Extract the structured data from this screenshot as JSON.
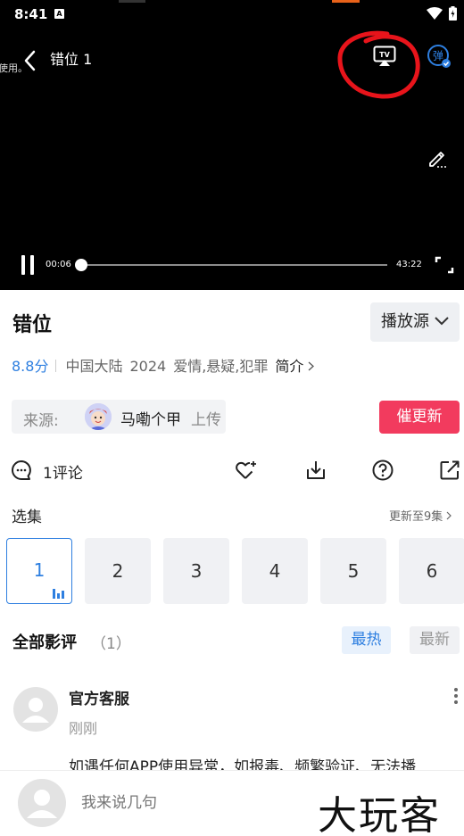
{
  "status_bar": {
    "time": "8:41",
    "notification_badge": "A",
    "icons": [
      "wifi-icon",
      "battery-icon"
    ]
  },
  "player": {
    "title": "错位 1",
    "clipped_text": "使用。",
    "cast_label": "TV",
    "danmu_label": "弹",
    "current_time": "00:06",
    "total_time": "43:22",
    "progress_fraction": 0.002,
    "annotation_color": "#e8141b"
  },
  "show": {
    "title": "错位",
    "source_button": "播放源",
    "score": "8.8分",
    "region": "中国大陆",
    "year": "2024",
    "genres": "爱情,悬疑,犯罪",
    "intro_link": "简介"
  },
  "uploader": {
    "label": "来源:",
    "name": "马嘞个甲",
    "suffix": "上传"
  },
  "urge_button": "催更新",
  "actions": {
    "comment_count": "1评论",
    "icons": [
      "heart-plus-icon",
      "download-icon",
      "help-icon",
      "share-icon"
    ]
  },
  "episodes": {
    "label": "选集",
    "update_text": "更新至9集",
    "items": [
      "1",
      "2",
      "3",
      "4",
      "5",
      "6"
    ],
    "active": "1"
  },
  "reviews": {
    "title": "全部影评",
    "count": "（1）",
    "sort_hot": "最热",
    "sort_new": "最新"
  },
  "comment": {
    "author": "官方客服",
    "time": "刚刚",
    "text": "如遇任何APP使用异常，如报毒、频繁验证、无法播"
  },
  "bottom": {
    "input_placeholder": "我来说几句",
    "watermark": "大玩客"
  },
  "colors": {
    "accent": "#2e7fe0",
    "urge": "#f23b5e",
    "player_bg": "#000000"
  }
}
